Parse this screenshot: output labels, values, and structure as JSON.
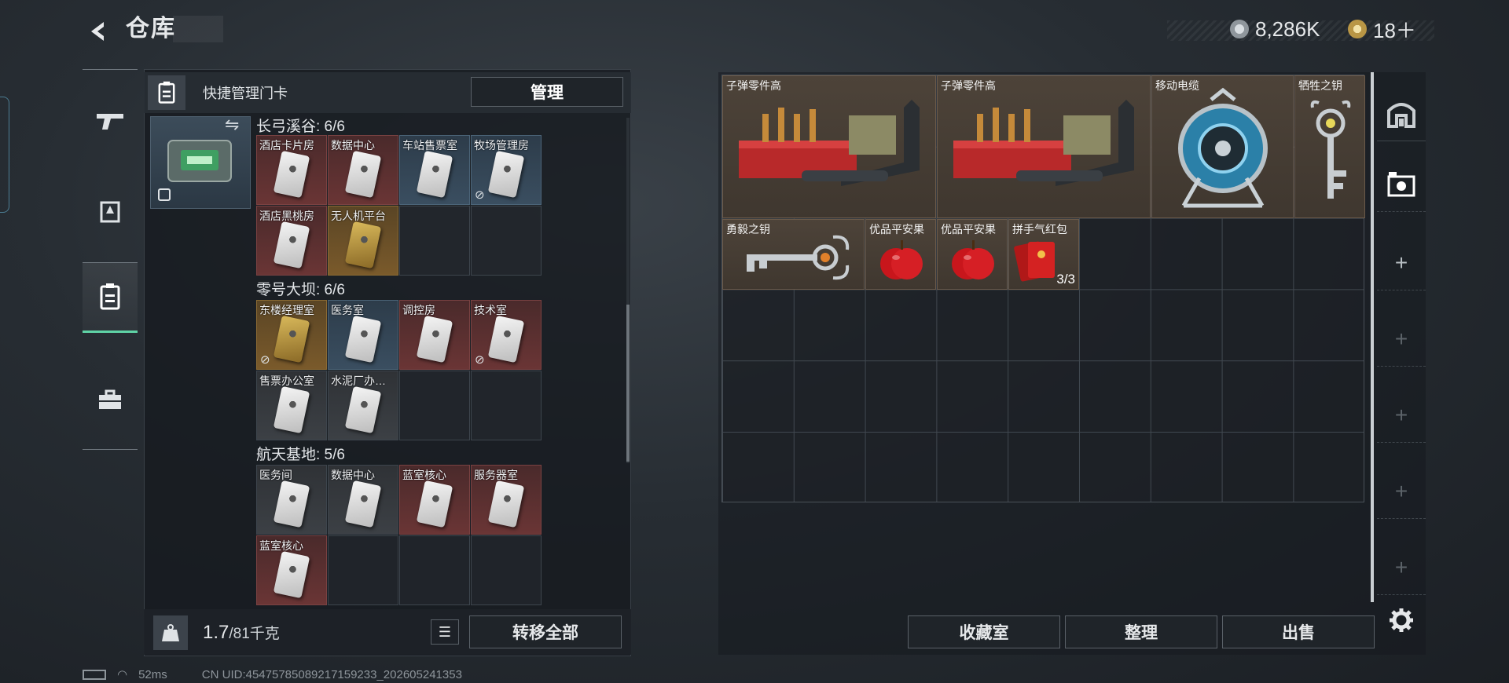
{
  "header": {
    "title": "仓库"
  },
  "currency": {
    "coins": "8,286K",
    "tickets": "18＋"
  },
  "left_nav": [
    "gun-icon",
    "armor-icon",
    "keycard-icon",
    "toolbox-icon"
  ],
  "keycard_panel": {
    "title": "快捷管理门卡",
    "manage_label": "管理",
    "groups": [
      {
        "title": "长弓溪谷: 6/6",
        "cells": [
          {
            "label": "酒店卡片房",
            "style": "red",
            "noswap": false
          },
          {
            "label": "数据中心",
            "style": "red",
            "noswap": false
          },
          {
            "label": "车站售票室",
            "style": "blue",
            "noswap": false
          },
          {
            "label": "牧场管理房",
            "style": "blue",
            "noswap": true
          },
          {
            "label": "酒店黑桃房",
            "style": "red",
            "noswap": false
          },
          {
            "label": "无人机平台",
            "style": "gold",
            "noswap": false
          }
        ]
      },
      {
        "title": "零号大坝: 6/6",
        "cells": [
          {
            "label": "东楼经理室",
            "style": "gold",
            "noswap": true
          },
          {
            "label": "医务室",
            "style": "blue",
            "noswap": false
          },
          {
            "label": "调控房",
            "style": "red",
            "noswap": false
          },
          {
            "label": "技术室",
            "style": "red",
            "noswap": true
          },
          {
            "label": "售票办公室",
            "style": "gray",
            "noswap": false
          },
          {
            "label": "水泥厂办…",
            "style": "gray",
            "noswap": false
          }
        ]
      },
      {
        "title": "航天基地: 5/6",
        "cells": [
          {
            "label": "医务间",
            "style": "gray",
            "noswap": false
          },
          {
            "label": "数据中心",
            "style": "gray",
            "noswap": false
          },
          {
            "label": "蓝室核心",
            "style": "red",
            "noswap": false
          },
          {
            "label": "服务器室",
            "style": "red",
            "noswap": false
          },
          {
            "label": "蓝室核心",
            "style": "red",
            "noswap": false
          }
        ]
      }
    ],
    "weight": {
      "current": "1.7",
      "max": "/81千克"
    },
    "transfer_label": "转移全部"
  },
  "stash": {
    "items": [
      {
        "label": "子弹零件高",
        "icon": "ammo-crate-icon"
      },
      {
        "label": "子弹零件高",
        "icon": "ammo-crate-icon"
      },
      {
        "label": "移动电缆",
        "icon": "cable-reel-icon"
      },
      {
        "label": "牺牲之钥",
        "icon": "key-icon"
      },
      {
        "label": "勇毅之钥",
        "icon": "key-icon"
      },
      {
        "label": "优品平安果",
        "icon": "apple-icon"
      },
      {
        "label": "优品平安果",
        "icon": "apple-icon"
      },
      {
        "label": "拼手气红包",
        "icon": "red-envelope-icon",
        "count": "3/3"
      }
    ],
    "buttons": {
      "collection": "收藏室",
      "sort": "整理",
      "sell": "出售"
    }
  },
  "side_tools": [
    "stash-tab-icon",
    "expand-stash-icon",
    "plus-icon",
    "plus-icon",
    "plus-icon",
    "plus-icon",
    "plus-icon",
    "plus-icon",
    "settings-icon"
  ],
  "status": {
    "ping": "52ms",
    "uid": "CN UID:45475785089217159233_202605241353"
  },
  "colors": {
    "accent": "#5fd3a6",
    "item_bg": "#4d4339"
  }
}
